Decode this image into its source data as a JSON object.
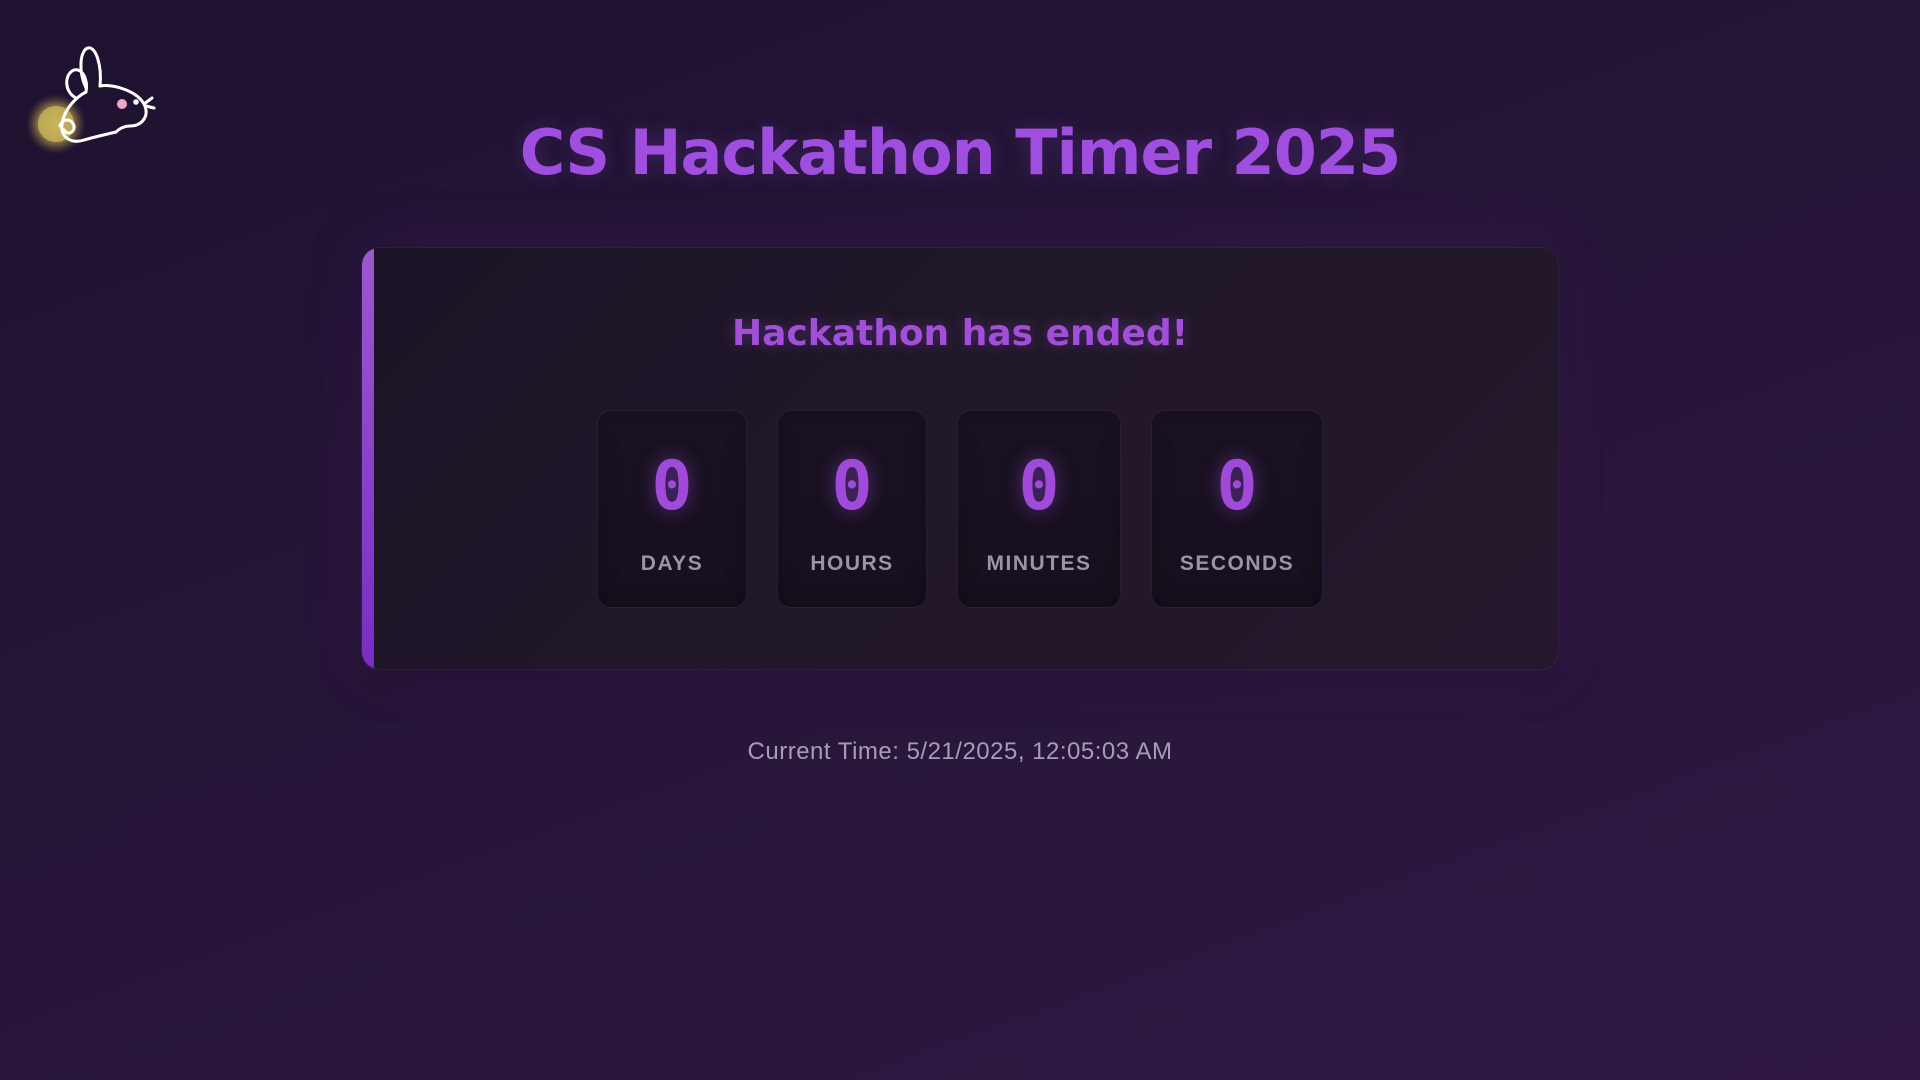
{
  "header": {
    "title": "CS Hackathon Timer 2025",
    "logo_icon": "rabbit-logo-icon"
  },
  "timer": {
    "status": "Hackathon has ended!",
    "units": [
      {
        "value": "0",
        "label": "DAYS"
      },
      {
        "value": "0",
        "label": "HOURS"
      },
      {
        "value": "0",
        "label": "MINUTES"
      },
      {
        "value": "0",
        "label": "SECONDS"
      }
    ]
  },
  "footer": {
    "current_time": "Current Time: 5/21/2025, 12:05:03 AM"
  },
  "colors": {
    "accent": "#a04ee0",
    "background": "#261638",
    "card": "#1f1628",
    "muted_text": "#9c93aa"
  }
}
